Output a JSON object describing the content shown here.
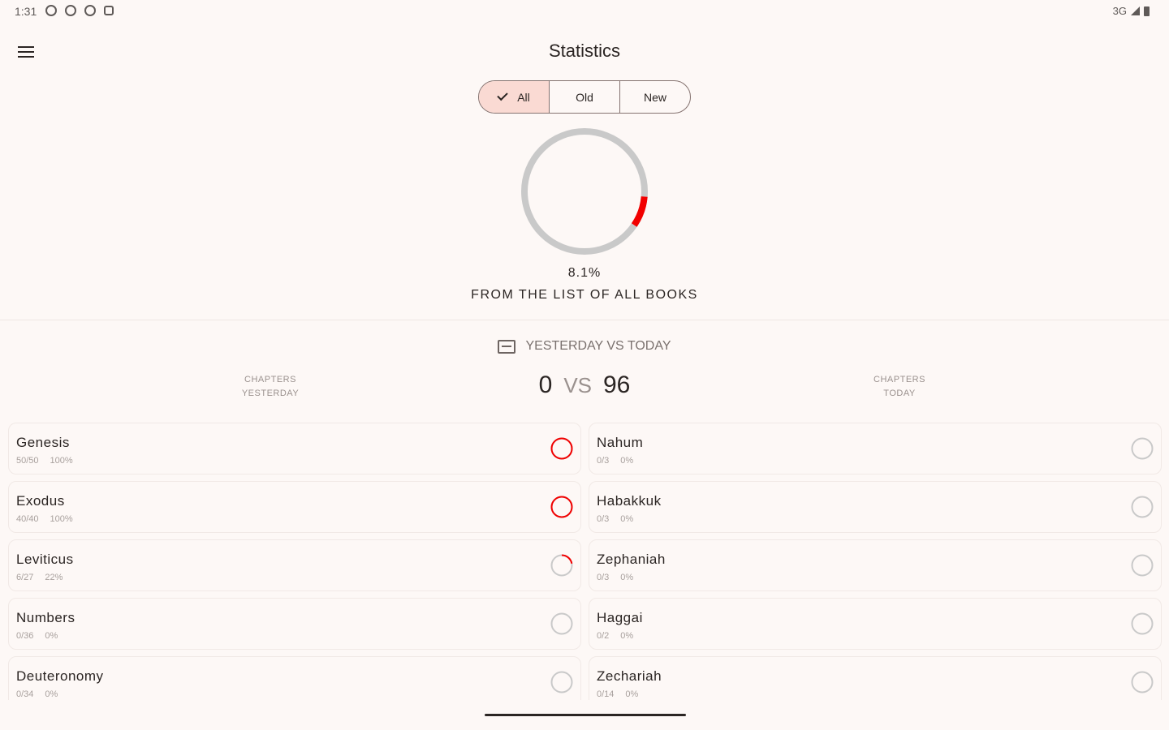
{
  "status": {
    "time": "1:31",
    "network": "3G",
    "icons": [
      "vpn-icon",
      "info-icon",
      "shield-icon",
      "square-icon",
      "signal-icon",
      "battery-icon"
    ]
  },
  "header": {
    "title": "Statistics",
    "menu_icon": "hamburger-menu-icon"
  },
  "filters": {
    "options": [
      {
        "label": "All",
        "selected": true
      },
      {
        "label": "Old",
        "selected": false
      },
      {
        "label": "New",
        "selected": false
      }
    ]
  },
  "overall": {
    "percent_text": "8.1%",
    "progress_fraction": 0.081,
    "caption": "FROM THE LIST OF ALL BOOKS"
  },
  "comparison": {
    "header": "YESTERDAY VS TODAY",
    "left_label_line1": "CHAPTERS",
    "left_label_line2": "YESTERDAY",
    "right_label_line1": "CHAPTERS",
    "right_label_line2": "TODAY",
    "yesterday_value": "0",
    "vs_text": "VS",
    "today_value": "96"
  },
  "colors": {
    "accent": "#f20000",
    "track": "#c9c9c9",
    "selected_segment": "#fadad3",
    "background": "#fdf8f6"
  },
  "books_left": [
    {
      "name": "Genesis",
      "chapters": "50/50",
      "percent": "100%",
      "progress": 1.0
    },
    {
      "name": "Exodus",
      "chapters": "40/40",
      "percent": "100%",
      "progress": 1.0
    },
    {
      "name": "Leviticus",
      "chapters": "6/27",
      "percent": "22%",
      "progress": 0.22
    },
    {
      "name": "Numbers",
      "chapters": "0/36",
      "percent": "0%",
      "progress": 0
    },
    {
      "name": "Deuteronomy",
      "chapters": "0/34",
      "percent": "0%",
      "progress": 0
    }
  ],
  "books_right": [
    {
      "name": "Nahum",
      "chapters": "0/3",
      "percent": "0%",
      "progress": 0
    },
    {
      "name": "Habakkuk",
      "chapters": "0/3",
      "percent": "0%",
      "progress": 0
    },
    {
      "name": "Zephaniah",
      "chapters": "0/3",
      "percent": "0%",
      "progress": 0
    },
    {
      "name": "Haggai",
      "chapters": "0/2",
      "percent": "0%",
      "progress": 0
    },
    {
      "name": "Zechariah",
      "chapters": "0/14",
      "percent": "0%",
      "progress": 0
    }
  ]
}
